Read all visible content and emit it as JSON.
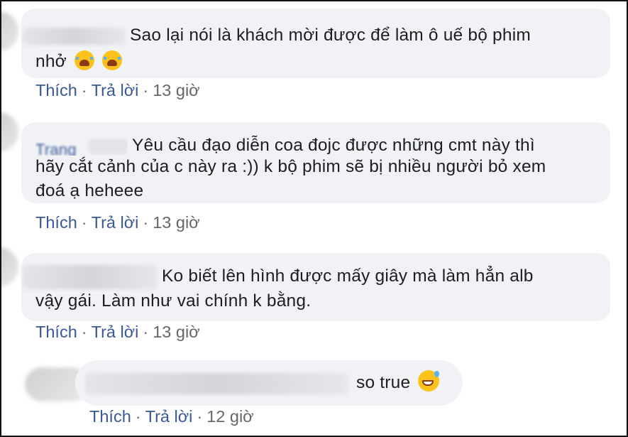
{
  "comments": [
    {
      "text_line1": "Sao lại nói là khách mời được để làm ô uế bộ phim",
      "text_line2": "nhở",
      "emojis": [
        "loudly-crying-face",
        "loudly-crying-face"
      ],
      "actions": {
        "like": "Thích",
        "reply": "Trả lời",
        "time": "13 giờ"
      }
    },
    {
      "author_partial": "Trang",
      "text_line1": "Yêu cầu đạo diễn coa đojc được những cmt này thì",
      "text_line2": "hãy cắt cảnh của c này ra :)) k bộ phim sẽ bị nhiều người bỏ xem",
      "text_line3": "đoá ạ heheee",
      "actions": {
        "like": "Thích",
        "reply": "Trả lời",
        "time": "13 giờ"
      }
    },
    {
      "text_line1": "Ko biết lên hình được mấy giây mà làm hẳn alb",
      "text_line2": "vậy gái. Làm như vai chính k bằng.",
      "actions": {
        "like": "Thích",
        "reply": "Trả lời",
        "time": "13 giờ"
      }
    },
    {
      "text_line1": "so true",
      "emojis": [
        "grinning-face-with-sweat"
      ],
      "actions": {
        "like": "Thích",
        "reply": "Trả lời",
        "time": "12 giờ"
      }
    }
  ],
  "colors": {
    "bubble": "#f0f2f5",
    "action_link": "#385898",
    "meta_text": "#65676b",
    "text": "#1c1e21"
  }
}
